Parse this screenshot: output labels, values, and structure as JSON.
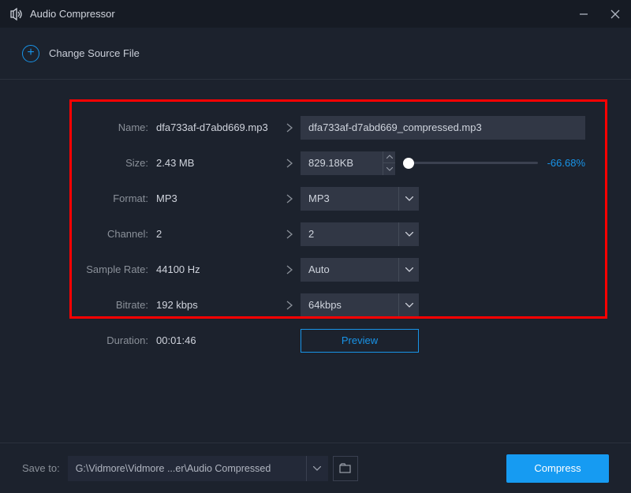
{
  "titlebar": {
    "title": "Audio Compressor"
  },
  "source": {
    "change_label": "Change Source File"
  },
  "fields": {
    "name": {
      "label": "Name:",
      "source": "dfa733af-d7abd669.mp3",
      "target": "dfa733af-d7abd669_compressed.mp3"
    },
    "size": {
      "label": "Size:",
      "source": "2.43 MB",
      "target": "829.18KB",
      "pct": "-66.68%"
    },
    "format": {
      "label": "Format:",
      "source": "MP3",
      "target": "MP3"
    },
    "channel": {
      "label": "Channel:",
      "source": "2",
      "target": "2"
    },
    "sample_rate": {
      "label": "Sample Rate:",
      "source": "44100 Hz",
      "target": "Auto"
    },
    "bitrate": {
      "label": "Bitrate:",
      "source": "192 kbps",
      "target": "64kbps"
    },
    "duration": {
      "label": "Duration:",
      "value": "00:01:46"
    }
  },
  "buttons": {
    "preview": "Preview",
    "compress": "Compress"
  },
  "save": {
    "label": "Save to:",
    "path": "G:\\Vidmore\\Vidmore ...er\\Audio Compressed"
  }
}
